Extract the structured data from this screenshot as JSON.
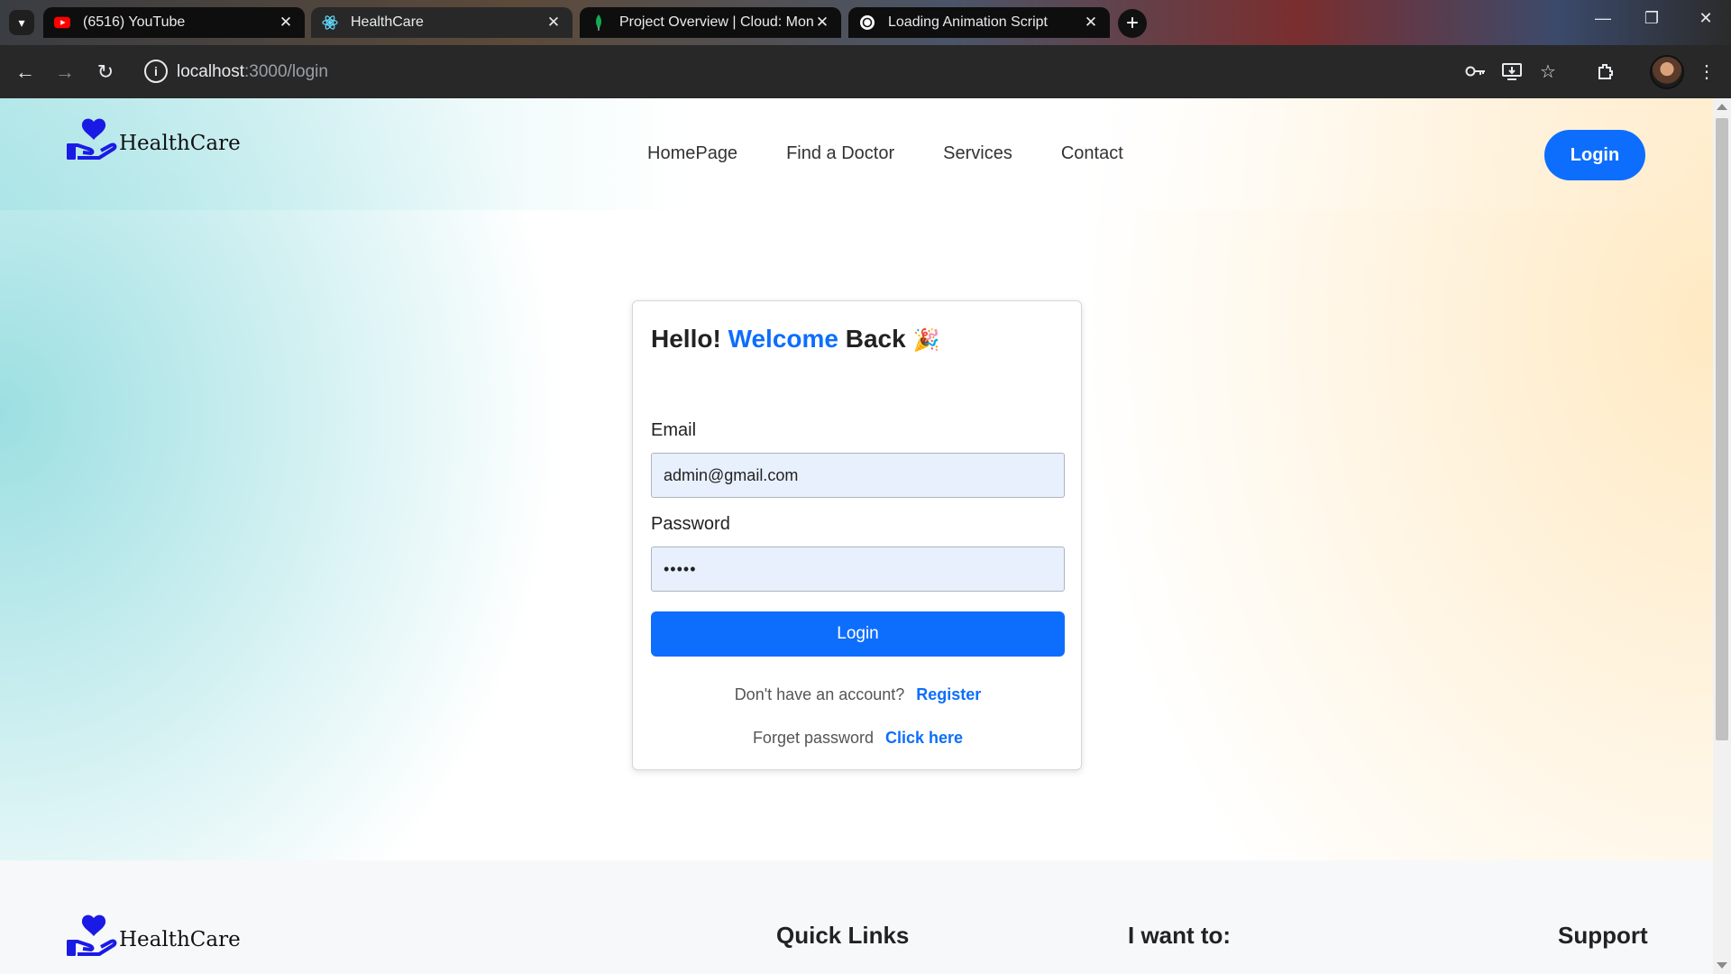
{
  "browser": {
    "tabs": [
      {
        "title": "(6516) YouTube",
        "icon": "youtube-icon"
      },
      {
        "title": "HealthCare",
        "icon": "react-icon"
      },
      {
        "title": "Project Overview | Cloud: Mong",
        "icon": "mongodb-leaf-icon"
      },
      {
        "title": "Loading Animation Script",
        "icon": "openai-icon"
      }
    ],
    "url_host": "localhost",
    "url_rest": ":3000/login"
  },
  "header": {
    "brand": "HealthCare",
    "nav": [
      "HomePage",
      "Find a Doctor",
      "Services",
      "Contact"
    ],
    "login_label": "Login"
  },
  "login_form": {
    "title_prefix": "Hello!",
    "title_accent": "Welcome",
    "title_suffix": "Back",
    "title_emoji": "🎉",
    "email_label": "Email",
    "email_value": "admin@gmail.com",
    "password_label": "Password",
    "password_value": "•••••",
    "submit_label": "Login",
    "register_prompt": "Don't have an account?",
    "register_link": "Register",
    "forgot_prompt": "Forget password",
    "forgot_link": "Click here"
  },
  "footer": {
    "brand": "HealthCare",
    "headings": [
      "Quick Links",
      "I want to:",
      "Support"
    ]
  },
  "colors": {
    "primary": "#0d6efd",
    "teal_glow": "#7ad4d8",
    "peach_glow": "#ffe4b4"
  }
}
